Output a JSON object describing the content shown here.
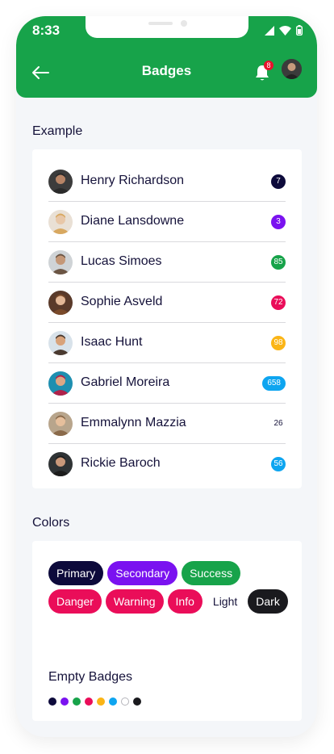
{
  "status": {
    "time": "8:33"
  },
  "header": {
    "title": "Badges",
    "notification_count": "8"
  },
  "sections": {
    "example": "Example",
    "colors": "Colors",
    "empty": "Empty Badges"
  },
  "contacts": [
    {
      "name": "Henry Richardson",
      "count": "7",
      "color": "#0d0a3b"
    },
    {
      "name": "Diane Lansdowne",
      "count": "3",
      "color": "#7a12f0"
    },
    {
      "name": "Lucas Simoes",
      "count": "85",
      "color": "#17a34a"
    },
    {
      "name": "Sophie Asveld",
      "count": "72",
      "color": "#ea0d59"
    },
    {
      "name": "Isaac Hunt",
      "count": "98",
      "color": "#fbb516"
    },
    {
      "name": "Gabriel Moreira",
      "count": "658",
      "color": "#0ea5f0"
    },
    {
      "name": "Emmalynn Mazzia",
      "count": "26",
      "color": "#ffffff"
    },
    {
      "name": "Rickie Baroch",
      "count": "56",
      "color": "#0ea5f0"
    }
  ],
  "color_badges": [
    {
      "label": "Primary",
      "color": "#0d0a3b"
    },
    {
      "label": "Secondary",
      "color": "#7a12f0"
    },
    {
      "label": "Success",
      "color": "#17a34a"
    },
    {
      "label": "Danger",
      "color": "#ea0d59"
    },
    {
      "label": "Warning",
      "color": "#ea0d59"
    },
    {
      "label": "Info",
      "color": "#ea0d59"
    },
    {
      "label": "Light",
      "color": "#ffffff"
    },
    {
      "label": "Dark",
      "color": "#1a1a1e"
    }
  ],
  "empty_badge_colors": [
    "#0d0a3b",
    "#7a12f0",
    "#17a34a",
    "#ea0d59",
    "#fbb516",
    "#0ea5f0",
    "#ffffff",
    "#1a1a1e"
  ]
}
